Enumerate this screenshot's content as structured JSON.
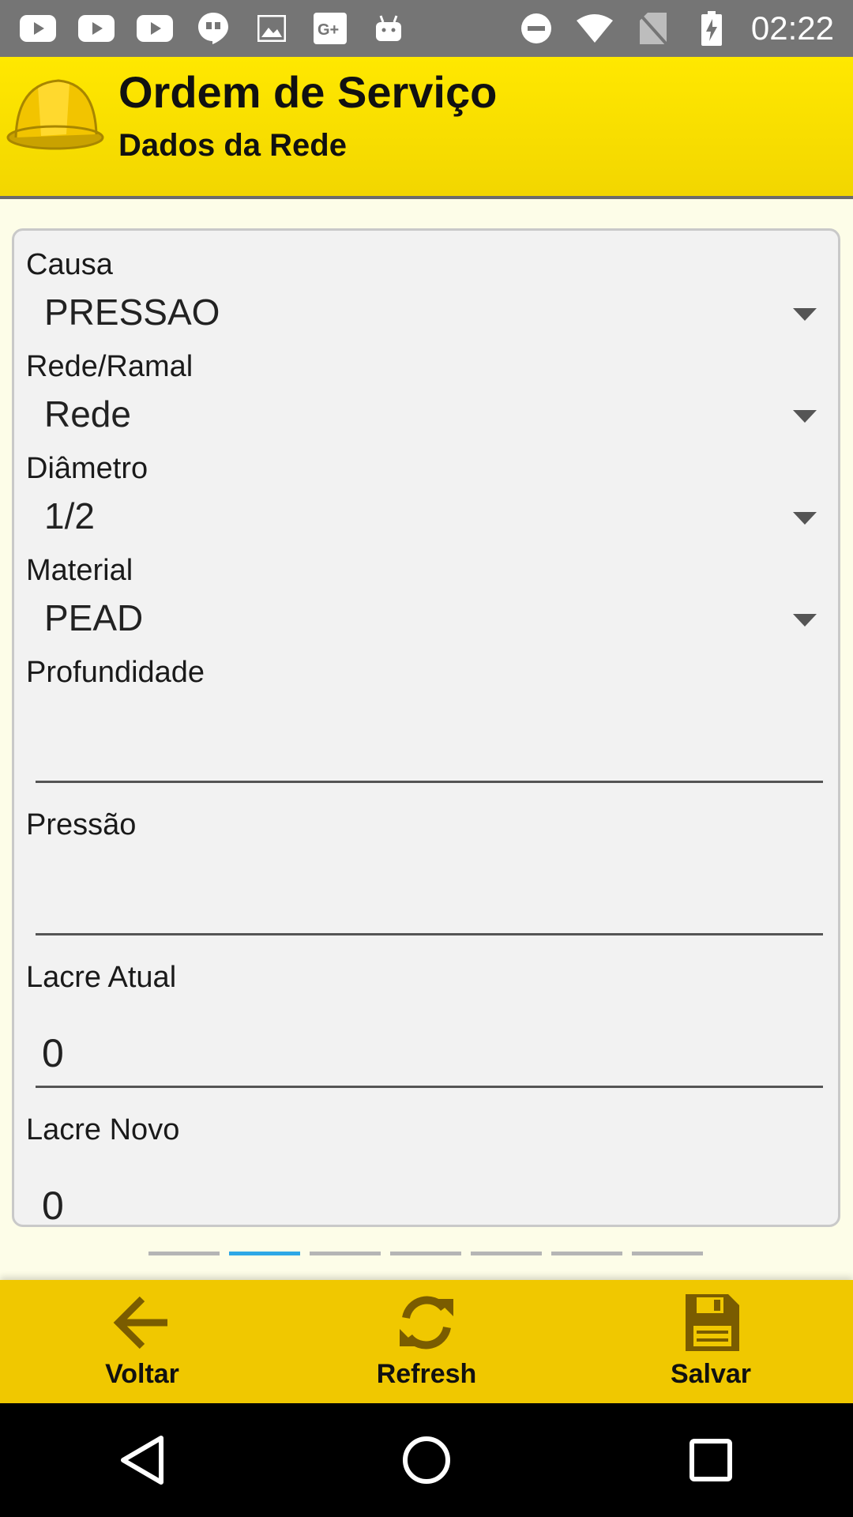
{
  "status": {
    "time": "02:22",
    "left_icons": [
      "youtube-icon",
      "youtube-icon",
      "youtube-icon",
      "quote-icon",
      "image-icon",
      "google-plus-icon",
      "android-icon"
    ],
    "right_icons": [
      "do-not-disturb-icon",
      "wifi-icon",
      "no-sim-icon",
      "battery-charging-icon"
    ]
  },
  "header": {
    "title": "Ordem de Serviço",
    "subtitle": "Dados da Rede",
    "logo_icon": "hard-hat-icon"
  },
  "form": {
    "causa": {
      "label": "Causa",
      "value": "PRESSAO"
    },
    "rede_ramal": {
      "label": "Rede/Ramal",
      "value": "Rede"
    },
    "diametro": {
      "label": "Diâmetro",
      "value": "1/2"
    },
    "material": {
      "label": "Material",
      "value": "PEAD"
    },
    "profundidade": {
      "label": "Profundidade",
      "value": ""
    },
    "pressao": {
      "label": "Pressão",
      "value": ""
    },
    "lacre_atual": {
      "label": "Lacre Atual",
      "value": "0"
    },
    "lacre_novo": {
      "label": "Lacre Novo",
      "value": "0"
    }
  },
  "pager": {
    "total": 7,
    "active_index": 1
  },
  "toolbar": {
    "back_label": "Voltar",
    "refresh_label": "Refresh",
    "save_label": "Salvar"
  },
  "colors": {
    "header_yellow": "#ffe800",
    "toolbar_yellow": "#f0c800",
    "icon_brown": "#7a5c00",
    "active_dash": "#2ea8e6"
  }
}
